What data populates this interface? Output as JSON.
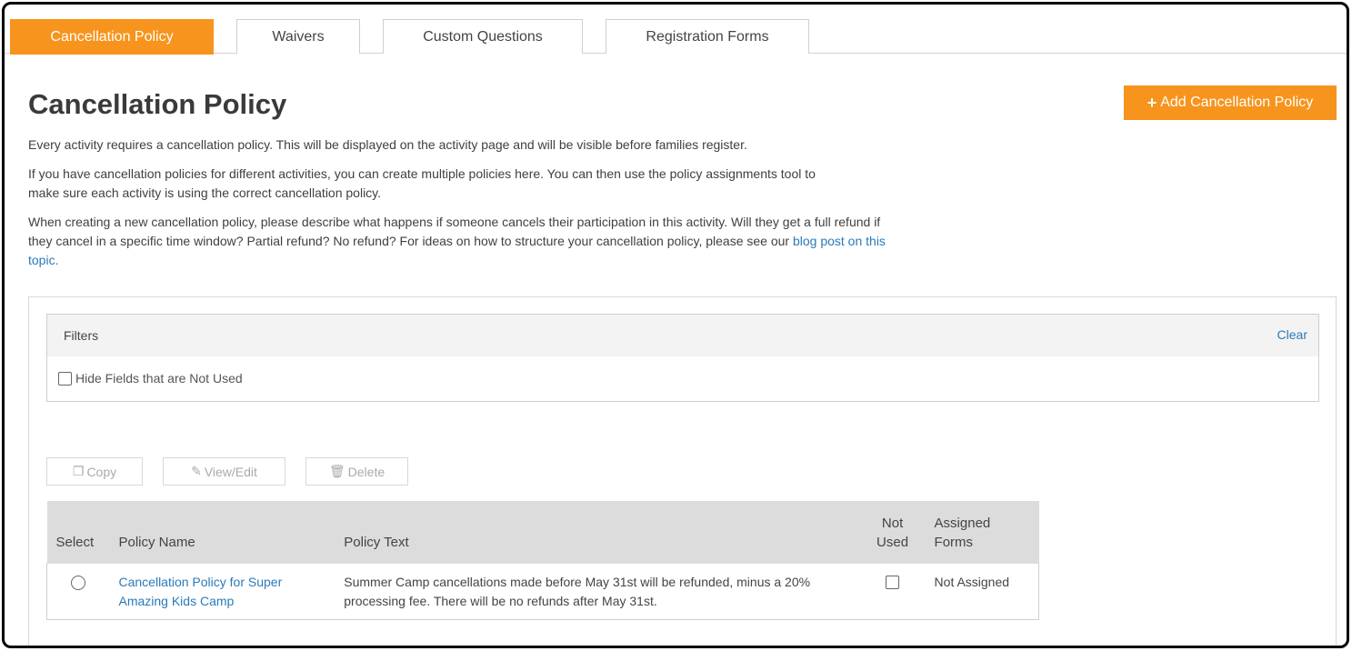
{
  "tabs": [
    {
      "label": "Cancellation Policy",
      "active": true
    },
    {
      "label": "Waivers",
      "active": false
    },
    {
      "label": "Custom Questions",
      "active": false
    },
    {
      "label": "Registration Forms",
      "active": false
    }
  ],
  "page": {
    "title": "Cancellation Policy",
    "add_button": "Add Cancellation Policy",
    "intro": "Every activity requires a cancellation policy. This will be displayed on the activity page and will be visible before families register.",
    "multi": "If you have cancellation policies for different activities, you can create multiple policies here. You can then use the policy assignments tool to make sure each activity is using the correct cancellation policy.",
    "creating": "When creating a new cancellation policy, please describe what happens if someone cancels their participation in this activity. Will they get a full refund if they cancel in a specific time window? Partial refund? No refund? For ideas on how to structure your cancellation policy, please see our ",
    "blog_link": "blog post on this topic."
  },
  "filters": {
    "title": "Filters",
    "clear": "Clear",
    "hide_unused": "Hide Fields that are Not Used"
  },
  "actions": {
    "copy": "Copy",
    "view_edit": "View/Edit",
    "delete": "Delete"
  },
  "table": {
    "headers": {
      "select": "Select",
      "policy_name": "Policy Name",
      "policy_text": "Policy Text",
      "not_used": "Not Used",
      "assigned_forms": "Assigned Forms"
    },
    "rows": [
      {
        "policy_name": "Cancellation Policy for Super Amazing Kids Camp",
        "policy_text": "Summer Camp cancellations made before May 31st will be refunded, minus a 20% processing fee. There will be no refunds after May 31st.",
        "assigned": "Not Assigned"
      }
    ]
  },
  "colors": {
    "accent": "#f7941d",
    "link": "#2a7ab8",
    "status_unassigned": "#d9534f"
  }
}
